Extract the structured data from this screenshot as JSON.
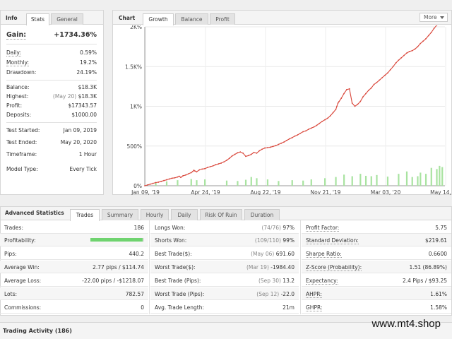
{
  "info": {
    "title": "Info",
    "tabs": [
      "Stats",
      "General"
    ],
    "gain": {
      "label": "Gain:",
      "value": "+1734.36%"
    },
    "rows": [
      {
        "label": "Daily:",
        "value": "0.59%"
      },
      {
        "label": "Monthly:",
        "value": "19.2%"
      },
      {
        "label": "Drawdown:",
        "value": "24.19%"
      },
      {
        "label": "Balance:",
        "value": "$18.3K"
      },
      {
        "label": "Highest:",
        "note": "(May 20)",
        "value": "$18.3K"
      },
      {
        "label": "Profit:",
        "value": "$17343.57"
      },
      {
        "label": "Deposits:",
        "value": "$1000.00"
      },
      {
        "label": "Test Started:",
        "value": "Jan 09, 2019"
      },
      {
        "label": "Test Ended:",
        "value": "May 20, 2020"
      },
      {
        "label": "Timeframe:",
        "value": "1 Hour"
      },
      {
        "label": "Model Type:",
        "value": "Every Tick"
      }
    ]
  },
  "chart_panel": {
    "title": "Chart",
    "tabs": [
      "Growth",
      "Balance",
      "Profit"
    ],
    "more_label": "More"
  },
  "chart_data": {
    "type": "line",
    "yticks": [
      "2K%",
      "1.5K%",
      "1K%",
      "500%",
      "0%"
    ],
    "xticks": [
      "Jan 09, '19",
      "Apr 24, '19",
      "Aug 22, '19",
      "Nov 21, '19",
      "Mar 03, '20",
      "May 14, '20"
    ],
    "ylim": [
      0,
      2000
    ],
    "line_color": "#d9463a",
    "bar_color": "#a8e3a0",
    "series": [
      {
        "x": [
          0,
          5,
          10,
          15,
          20,
          25,
          30,
          35,
          40,
          45,
          50,
          55,
          60,
          63,
          66,
          70,
          75,
          80,
          85,
          88,
          90,
          92,
          95,
          100,
          105,
          110,
          115,
          120,
          125,
          130,
          135,
          140,
          145,
          150,
          155,
          160,
          165,
          170,
          175,
          180,
          185,
          190,
          195,
          200,
          205,
          210,
          215,
          220,
          225,
          230,
          235,
          240,
          245,
          250,
          255,
          260,
          265,
          270,
          275,
          280,
          285,
          290,
          295,
          300,
          305,
          310,
          315,
          320,
          325,
          330,
          335,
          340,
          345,
          350,
          352,
          354,
          356,
          360,
          365,
          370,
          375,
          380,
          385,
          390,
          395,
          400,
          405,
          410,
          415,
          420,
          425,
          430,
          435,
          440,
          445,
          450,
          455,
          460,
          465,
          470,
          475,
          480,
          485,
          490,
          495,
          500,
          505,
          510,
          515,
          520,
          525,
          530,
          535,
          540,
          545,
          550
        ],
        "y": [
          0,
          10,
          20,
          30,
          40,
          45,
          55,
          65,
          75,
          85,
          95,
          100,
          110,
          120,
          105,
          125,
          135,
          150,
          165,
          180,
          195,
          185,
          175,
          200,
          210,
          215,
          230,
          240,
          250,
          265,
          275,
          285,
          300,
          320,
          345,
          375,
          395,
          415,
          425,
          410,
          370,
          380,
          395,
          420,
          410,
          440,
          460,
          475,
          480,
          485,
          495,
          505,
          520,
          535,
          550,
          570,
          590,
          605,
          625,
          640,
          660,
          680,
          690,
          710,
          725,
          740,
          760,
          785,
          810,
          830,
          850,
          880,
          920,
          960,
          1000,
          1040,
          1060,
          1100,
          1160,
          1210,
          1220,
          1040,
          1000,
          1025,
          1060,
          1120,
          1160,
          1200,
          1230,
          1275,
          1300,
          1330,
          1360,
          1390,
          1420,
          1460,
          1500,
          1545,
          1580,
          1610,
          1640,
          1670,
          1690,
          1700,
          1720,
          1750,
          1790,
          1820,
          1850,
          1890,
          1930,
          1980,
          2020,
          2060,
          2110,
          2150
        ]
      }
    ],
    "bars": {
      "x": [
        20,
        40,
        60,
        85,
        95,
        110,
        150,
        170,
        185,
        195,
        205,
        225,
        245,
        270,
        290,
        305,
        330,
        350,
        365,
        380,
        395,
        405,
        415,
        425,
        445,
        465,
        480,
        490,
        500,
        505,
        515,
        525,
        535,
        540,
        545
      ],
      "y": [
        40,
        55,
        70,
        85,
        70,
        80,
        65,
        60,
        75,
        110,
        95,
        80,
        60,
        70,
        65,
        80,
        95,
        110,
        140,
        120,
        150,
        125,
        120,
        135,
        115,
        150,
        180,
        110,
        120,
        165,
        150,
        225,
        210,
        250,
        235
      ]
    }
  },
  "adv": {
    "title": "Advanced Statistics",
    "tabs": [
      "Trades",
      "Summary",
      "Hourly",
      "Daily",
      "Risk Of Ruin",
      "Duration"
    ],
    "col1": [
      {
        "label": "Trades:",
        "value": "186"
      },
      {
        "label": "Profitability:",
        "value": ""
      },
      {
        "label": "Pips:",
        "value": "440.2"
      },
      {
        "label": "Average Win:",
        "value": "2.77 pips / $114.74"
      },
      {
        "label": "Average Loss:",
        "value": "-22.00 pips / -$1218.07"
      },
      {
        "label": "Lots:",
        "value": "782.57"
      },
      {
        "label": "Commissions:",
        "value": "0"
      }
    ],
    "profitability_pct": 97,
    "col2": [
      {
        "label": "Longs Won:",
        "note": "(74/76)",
        "value": "97%"
      },
      {
        "label": "Shorts Won:",
        "note": "(109/110)",
        "value": "99%"
      },
      {
        "label": "Best Trade($):",
        "note": "(May 06)",
        "value": "691.60"
      },
      {
        "label": "Worst Trade($):",
        "note": "(Mar 19)",
        "value": "-1984.40"
      },
      {
        "label": "Best Trade (Pips):",
        "note": "(Sep 30)",
        "value": "13.2"
      },
      {
        "label": "Worst Trade (Pips):",
        "note": "(Sep 12)",
        "value": "-22.0"
      },
      {
        "label": "Avg. Trade Length:",
        "note": "",
        "value": "21m"
      }
    ],
    "col3": [
      {
        "label": "Profit Factor:",
        "value": "5.75"
      },
      {
        "label": "Standard Deviation:",
        "value": "$219.61"
      },
      {
        "label": "Sharpe Ratio:",
        "value": "0.6600"
      },
      {
        "label": "Z-Score (Probability):",
        "value": "1.51 (86.89%)"
      },
      {
        "label": "Expectancy:",
        "value": "2.4 Pips / $93.25"
      },
      {
        "label": "AHPR:",
        "value": "1.61%"
      },
      {
        "label": "GHPR:",
        "value": "1.58%"
      }
    ]
  },
  "trading_activity": {
    "label": "Trading Activity (186)"
  },
  "watermark": "www.mt4.shop"
}
